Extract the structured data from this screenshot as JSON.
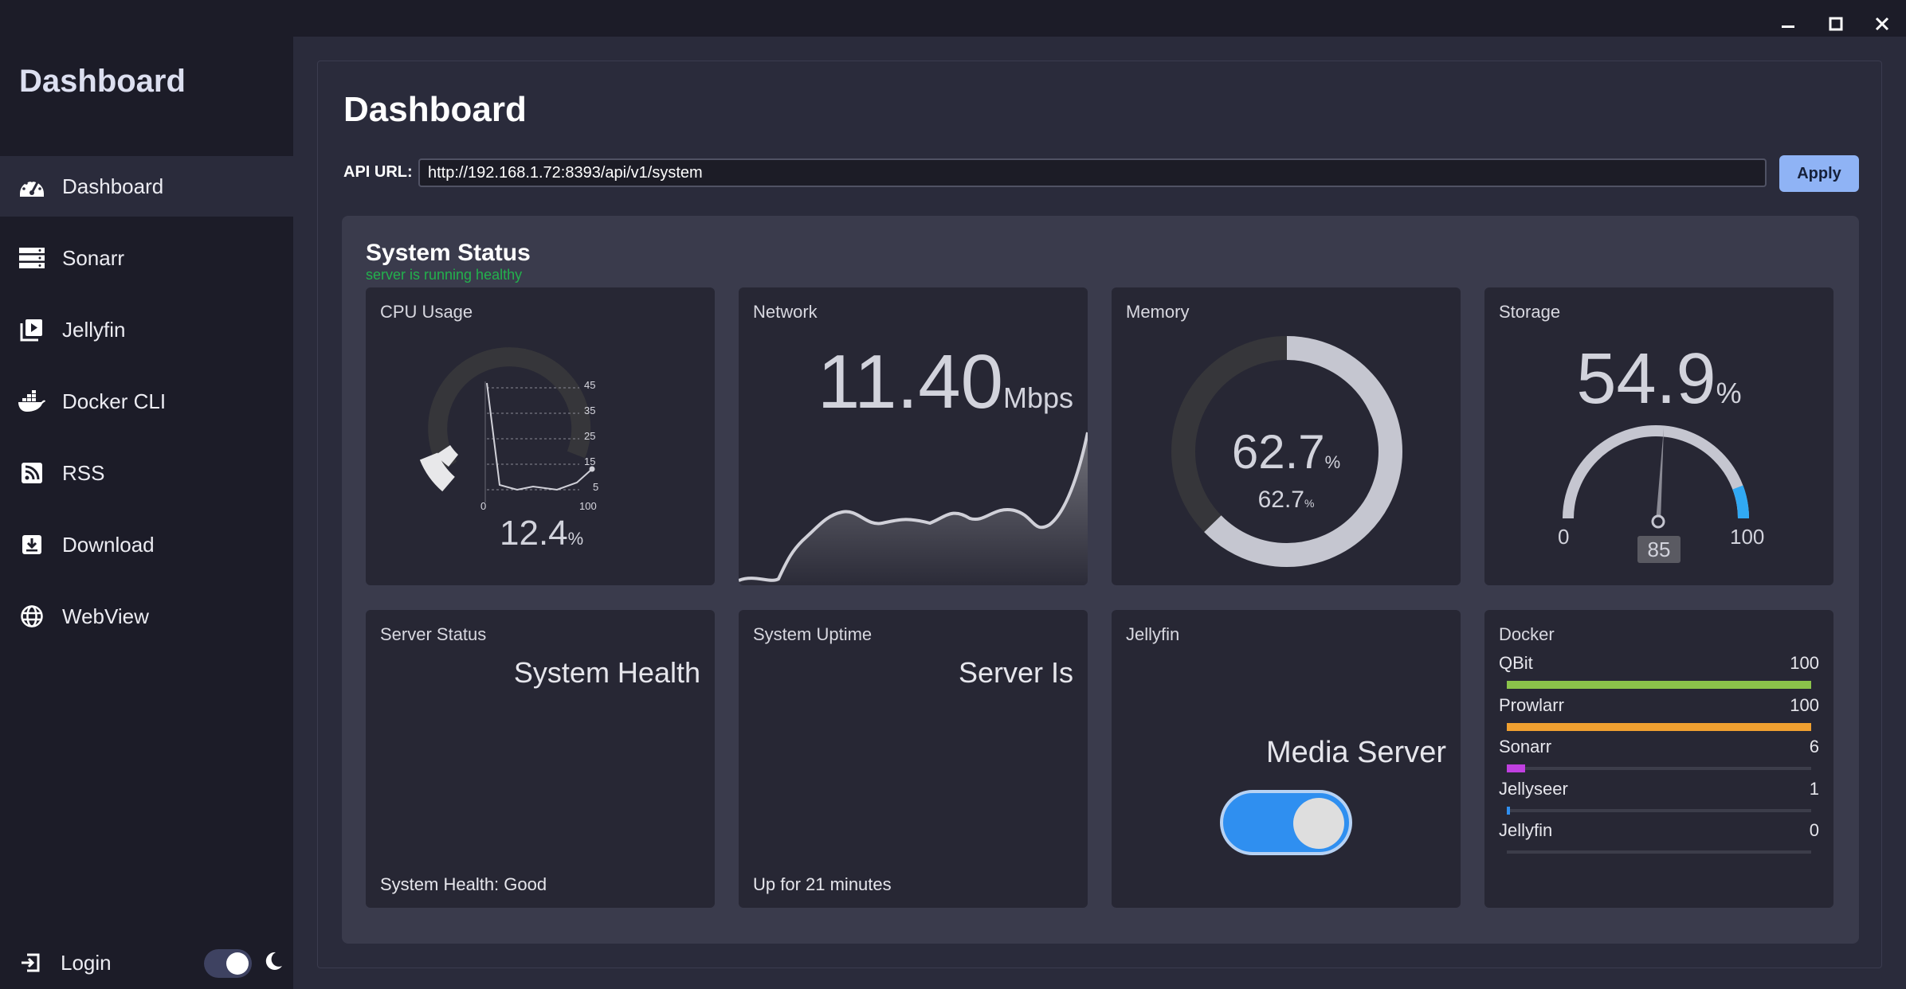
{
  "window": {
    "minimize_icon": "minimize-icon",
    "maximize_icon": "maximize-icon",
    "close_icon": "close-icon"
  },
  "sidebar": {
    "title": "Dashboard",
    "items": [
      {
        "label": "Dashboard",
        "icon": "speedometer-icon",
        "active": true
      },
      {
        "label": "Sonarr",
        "icon": "server-icon",
        "active": false
      },
      {
        "label": "Jellyfin",
        "icon": "video-library-icon",
        "active": false
      },
      {
        "label": "Docker CLI",
        "icon": "docker-icon",
        "active": false
      },
      {
        "label": "RSS",
        "icon": "rss-icon",
        "active": false
      },
      {
        "label": "Download",
        "icon": "download-icon",
        "active": false
      },
      {
        "label": "WebView",
        "icon": "globe-icon",
        "active": false
      }
    ],
    "login_label": "Login",
    "theme_toggle_on": true
  },
  "main": {
    "title": "Dashboard",
    "api_label": "API URL:",
    "api_url": "http://192.168.1.72:8393/api/v1/system",
    "apply_label": "Apply",
    "status_title": "System Status",
    "status_subtitle": "server is running healthy"
  },
  "cards": {
    "cpu": {
      "label": "CPU Usage",
      "value": "12.4",
      "unit": "%",
      "ticks": [
        "45",
        "35",
        "25",
        "15",
        "5"
      ],
      "x_start": "0",
      "x_end": "100"
    },
    "network": {
      "label": "Network",
      "value": "11.40",
      "unit": "Mbps"
    },
    "memory": {
      "label": "Memory",
      "value": "62.7",
      "unit": "%",
      "value2": "62.7",
      "unit2": "%"
    },
    "storage": {
      "label": "Storage",
      "value": "54.9",
      "unit": "%",
      "min": "0",
      "max": "100",
      "needle": "85"
    },
    "server_status": {
      "label": "Server Status",
      "headline": "System Health",
      "footer": "System Health: Good"
    },
    "uptime": {
      "label": "System Uptime",
      "headline": "Server Is",
      "footer": "Up for 21 minutes"
    },
    "jellyfin": {
      "label": "Jellyfin",
      "headline": "Media Server",
      "toggle_on": true
    },
    "docker": {
      "label": "Docker",
      "rows": [
        {
          "name": "QBit",
          "value": "100",
          "color": "#8bc34a"
        },
        {
          "name": "Prowlarr",
          "value": "100",
          "color": "#f0a030"
        },
        {
          "name": "Sonarr",
          "value": "6",
          "color": "#c040e0"
        },
        {
          "name": "Jellyseer",
          "value": "1",
          "color": "#2f8ff0"
        },
        {
          "name": "Jellyfin",
          "value": "0",
          "color": "#3c3d4a"
        }
      ]
    }
  },
  "colors": {
    "accent": "#8fb3f5",
    "healthy": "#23b14d",
    "toggle": "#2f8ff0"
  }
}
